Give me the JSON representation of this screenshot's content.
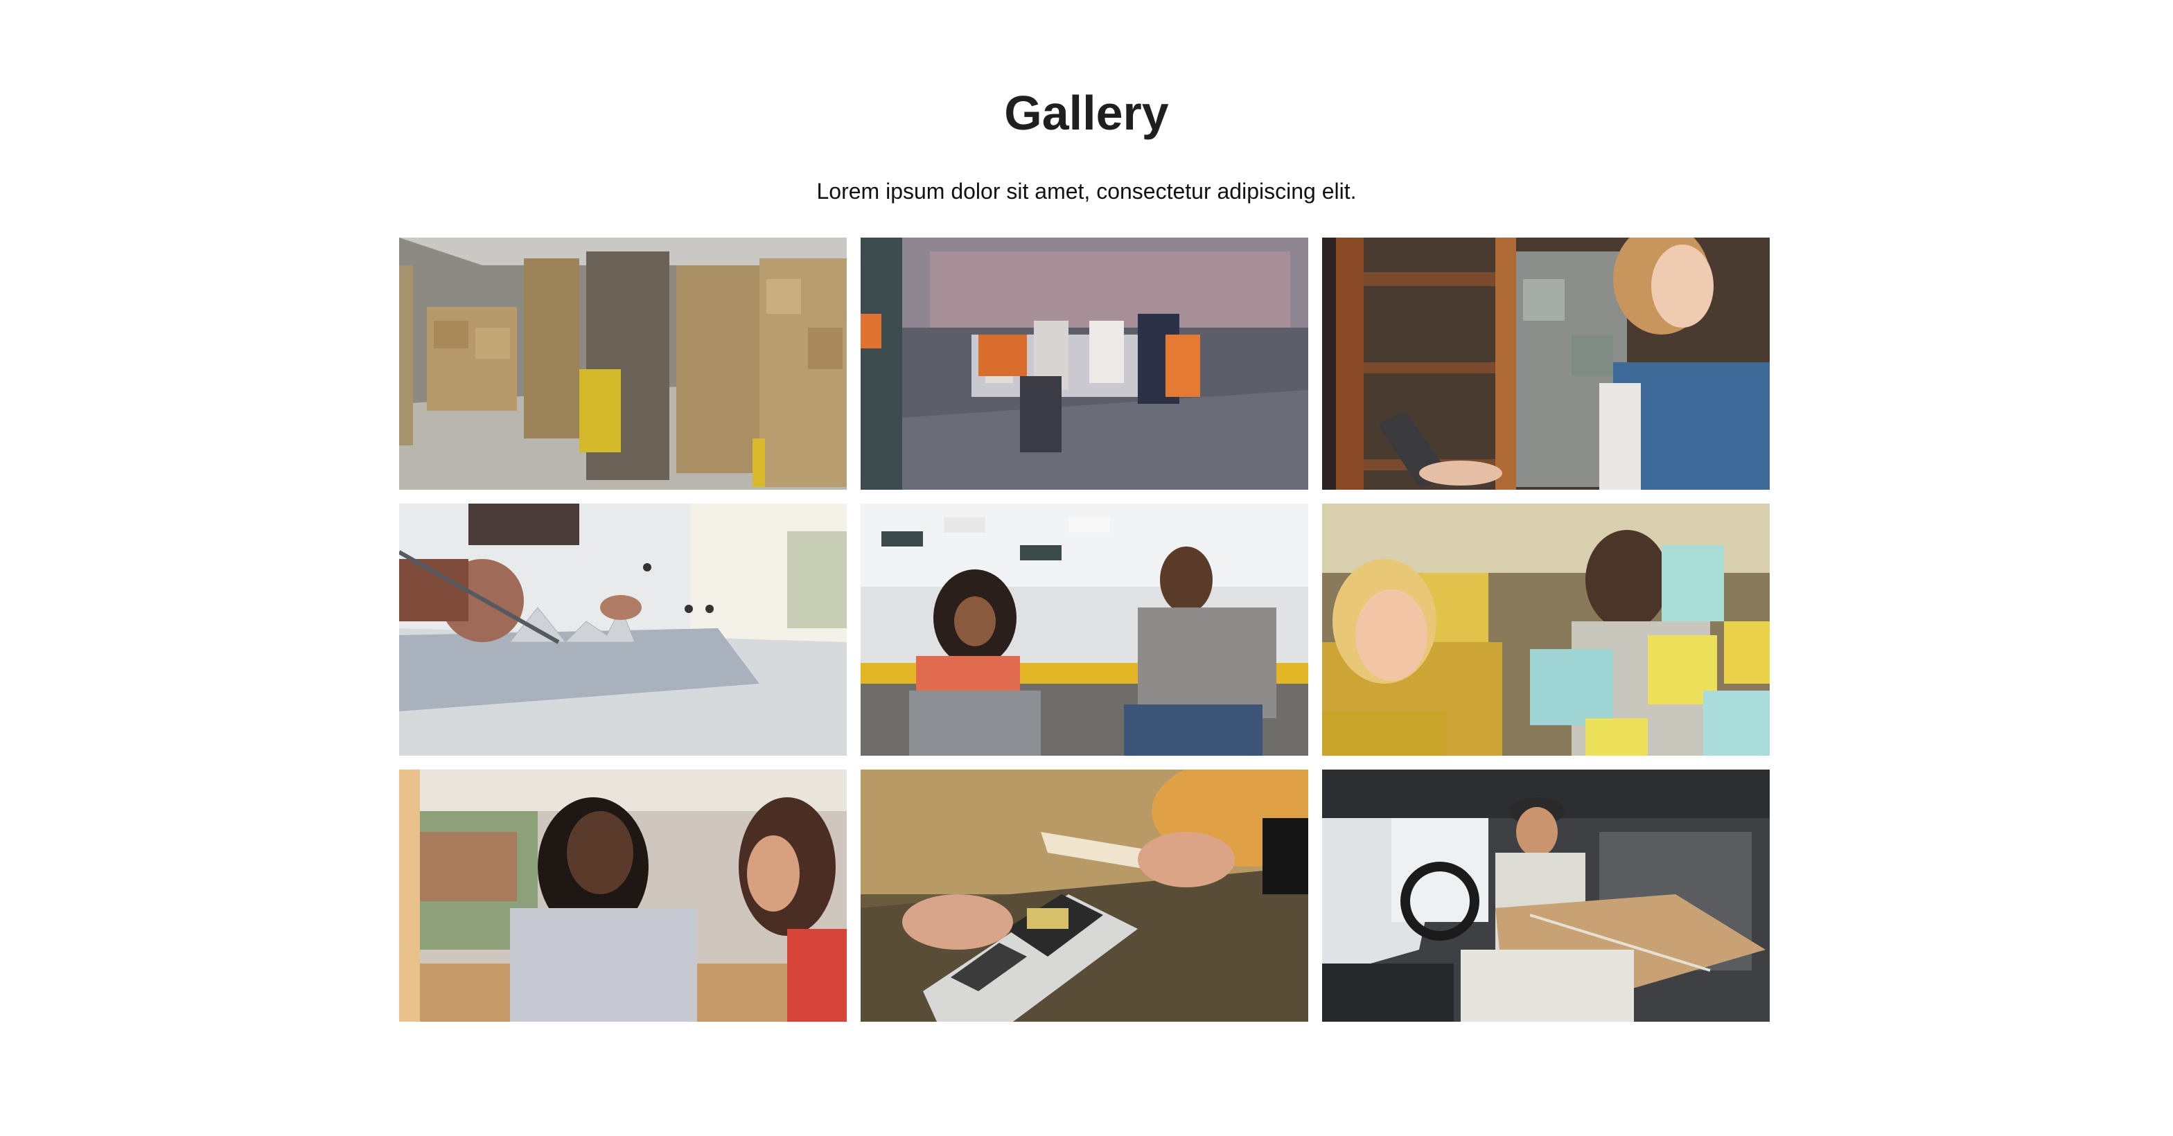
{
  "header": {
    "title": "Gallery",
    "subtitle": "Lorem ipsum dolor sit amet, consectetur adipiscing elit."
  },
  "gallery": {
    "images": [
      {
        "name": "warehouse-forklift-photo"
      },
      {
        "name": "office-meeting-photo"
      },
      {
        "name": "shop-owner-tablet-photo"
      },
      {
        "name": "financial-charts-analysis-photo"
      },
      {
        "name": "colleagues-laptop-laughing-photo"
      },
      {
        "name": "sticky-notes-brainstorm-photo"
      },
      {
        "name": "women-working-together-photo"
      },
      {
        "name": "contactless-payment-photo"
      },
      {
        "name": "delivery-van-parcel-photo"
      }
    ]
  }
}
